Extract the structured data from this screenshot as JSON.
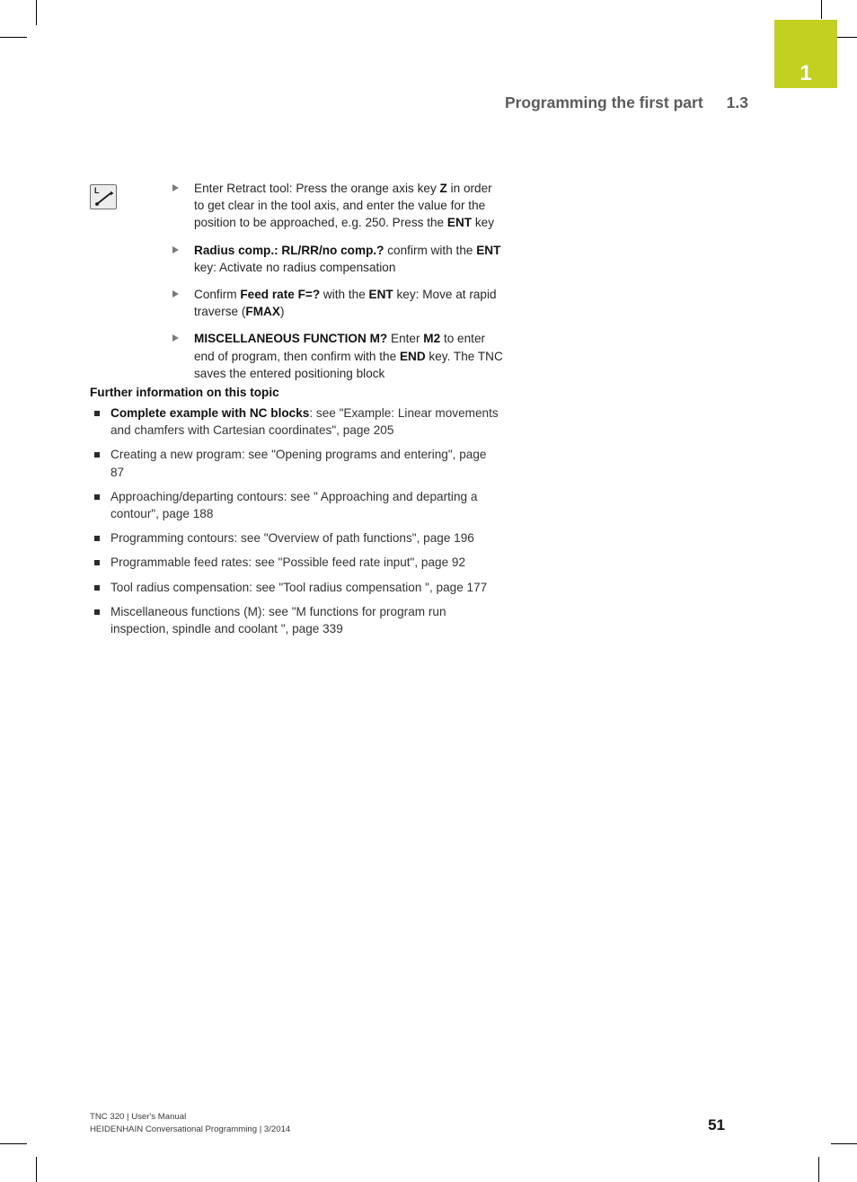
{
  "chapter_tab": {
    "number": "1",
    "color": "#c2d021"
  },
  "header": {
    "title": "Programming the first part",
    "section": "1.3",
    "color": "#5b5b5b"
  },
  "key_icon": {
    "name": "straight-line-L-key",
    "letter": "L"
  },
  "procedure": {
    "items": [
      {
        "parts": [
          {
            "text": "Enter Retract tool: Press the orange axis key ",
            "bold": false
          },
          {
            "text": "Z",
            "bold": true
          },
          {
            "text": " in order to get clear in the tool axis, and enter the value for the position to be approached, e.g. 250. Press the ",
            "bold": false
          },
          {
            "text": "ENT",
            "bold": true
          },
          {
            "text": " key",
            "bold": false
          }
        ]
      },
      {
        "parts": [
          {
            "text": "Radius comp.: RL/RR/no comp.?",
            "bold": true
          },
          {
            "text": " confirm with the ",
            "bold": false
          },
          {
            "text": "ENT",
            "bold": true
          },
          {
            "text": "  key: Activate no radius compensation",
            "bold": false
          }
        ]
      },
      {
        "parts": [
          {
            "text": "Confirm ",
            "bold": false
          },
          {
            "text": "Feed rate F=?",
            "bold": true
          },
          {
            "text": " with the ",
            "bold": false
          },
          {
            "text": "ENT",
            "bold": true
          },
          {
            "text": " key: Move at rapid traverse (",
            "bold": false
          },
          {
            "text": "FMAX",
            "bold": true
          },
          {
            "text": ")",
            "bold": false
          }
        ]
      },
      {
        "parts": [
          {
            "text": "MISCELLANEOUS FUNCTION M?",
            "bold": true
          },
          {
            "text": " Enter ",
            "bold": false
          },
          {
            "text": "M2",
            "bold": true
          },
          {
            "text": " to enter end of program, then confirm with the ",
            "bold": false
          },
          {
            "text": "END",
            "bold": true
          },
          {
            "text": " key. The TNC saves the entered positioning block",
            "bold": false
          }
        ]
      }
    ]
  },
  "further_information": {
    "heading": "Further information on this topic",
    "items": [
      {
        "parts": [
          {
            "text": "Complete example with NC blocks",
            "bold": true
          },
          {
            "text": ": see \"Example: Linear movements and chamfers with Cartesian coordinates\", page 205",
            "bold": false
          }
        ]
      },
      {
        "parts": [
          {
            "text": "Creating a new program: see \"Opening programs and entering\", page 87",
            "bold": false
          }
        ]
      },
      {
        "parts": [
          {
            "text": "Approaching/departing contours: see \" Approaching and departing a contour\", page 188",
            "bold": false
          }
        ]
      },
      {
        "parts": [
          {
            "text": "Programming contours: see \"Overview of path functions\", page 196",
            "bold": false
          }
        ]
      },
      {
        "parts": [
          {
            "text": "Programmable feed rates: see \"Possible feed rate input\", page 92",
            "bold": false
          }
        ]
      },
      {
        "parts": [
          {
            "text": "Tool radius compensation: see \"Tool radius compensation \", page 177",
            "bold": false
          }
        ]
      },
      {
        "parts": [
          {
            "text": "Miscellaneous functions (M): see \"M functions for program run inspection, spindle and coolant \", page 339",
            "bold": false
          }
        ]
      }
    ]
  },
  "footer": {
    "line1": "TNC 320 | User's Manual",
    "line2": "HEIDENHAIN Conversational Programming | 3/2014",
    "page_number": "51"
  }
}
